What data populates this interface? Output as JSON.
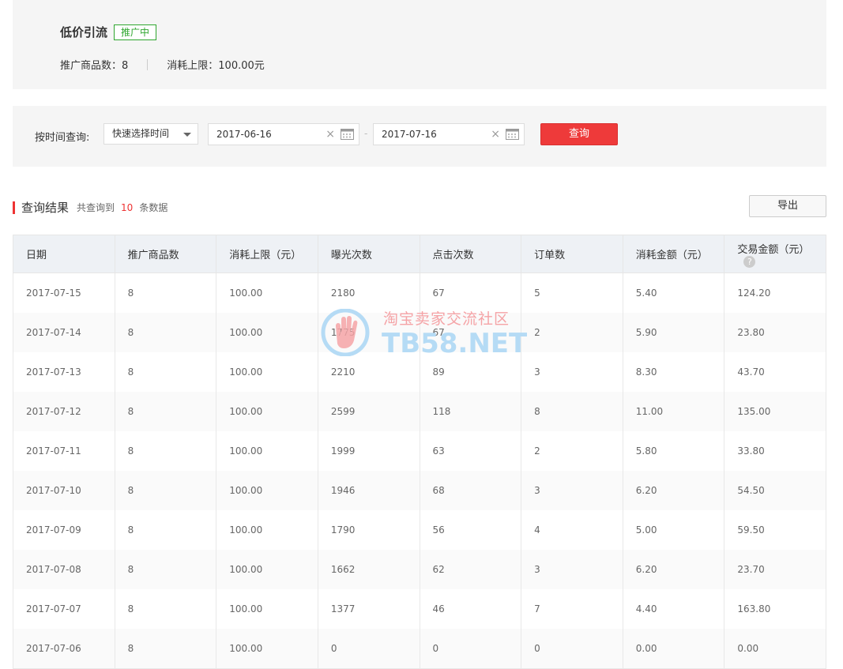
{
  "summary": {
    "title": "低价引流",
    "status": "推广中",
    "product_count_label": "推广商品数：8",
    "budget_label": "消耗上限：100.00元"
  },
  "filter": {
    "label": "按时间查询:",
    "select_value": "快速选择时间",
    "start_date": "2017-06-16",
    "end_date": "2017-07-16",
    "date_separator": "-",
    "clear_symbol": "×",
    "query_button": "查询"
  },
  "results": {
    "title": "查询结果",
    "count_prefix": "共查询到",
    "count": "10",
    "count_suffix": "条数据",
    "export_button": "导出",
    "help_symbol": "?"
  },
  "table": {
    "headers": [
      "日期",
      "推广商品数",
      "消耗上限（元）",
      "曝光次数",
      "点击次数",
      "订单数",
      "消耗金额（元）",
      "交易金额（元）"
    ],
    "rows": [
      [
        "2017-07-15",
        "8",
        "100.00",
        "2180",
        "67",
        "5",
        "5.40",
        "124.20"
      ],
      [
        "2017-07-14",
        "8",
        "100.00",
        "1775",
        "67",
        "2",
        "5.90",
        "23.80"
      ],
      [
        "2017-07-13",
        "8",
        "100.00",
        "2210",
        "89",
        "3",
        "8.30",
        "43.70"
      ],
      [
        "2017-07-12",
        "8",
        "100.00",
        "2599",
        "118",
        "8",
        "11.00",
        "135.00"
      ],
      [
        "2017-07-11",
        "8",
        "100.00",
        "1999",
        "63",
        "2",
        "5.80",
        "33.80"
      ],
      [
        "2017-07-10",
        "8",
        "100.00",
        "1946",
        "68",
        "3",
        "6.20",
        "54.50"
      ],
      [
        "2017-07-09",
        "8",
        "100.00",
        "1790",
        "56",
        "4",
        "5.00",
        "59.50"
      ],
      [
        "2017-07-08",
        "8",
        "100.00",
        "1662",
        "62",
        "3",
        "6.20",
        "23.70"
      ],
      [
        "2017-07-07",
        "8",
        "100.00",
        "1377",
        "46",
        "7",
        "4.40",
        "163.80"
      ],
      [
        "2017-07-06",
        "8",
        "100.00",
        "0",
        "0",
        "0",
        "0.00",
        "0.00"
      ]
    ]
  },
  "watermark": {
    "cn": "淘宝卖家交流社区",
    "en": "TB58.NET"
  },
  "colors": {
    "accent": "#ee3a3a",
    "status_green": "#2ea62e",
    "panel_bg": "#f5f5f5"
  }
}
